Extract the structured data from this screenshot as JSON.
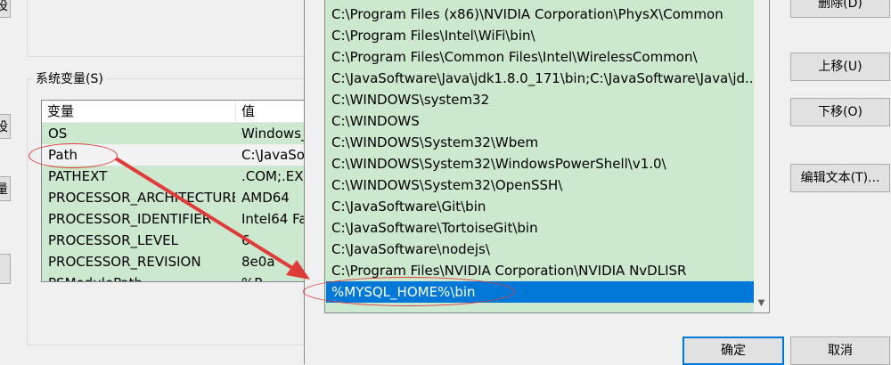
{
  "left_window": {
    "btn_fragments": [
      "设",
      "设",
      "量"
    ],
    "system_group_label": "系统变量(S)",
    "table": {
      "headers": [
        "变量",
        "值"
      ],
      "rows": [
        {
          "name": "OS",
          "value": "Windows_"
        },
        {
          "name": "Path",
          "value": "C:\\JavaSo"
        },
        {
          "name": "PATHEXT",
          "value": ".COM;.EX"
        },
        {
          "name": "PROCESSOR_ARCHITECTURE",
          "value": "AMD64"
        },
        {
          "name": "PROCESSOR_IDENTIFIER",
          "value": "Intel64 Fa"
        },
        {
          "name": "PROCESSOR_LEVEL",
          "value": "6"
        },
        {
          "name": "PROCESSOR_REVISION",
          "value": "8e0a"
        },
        {
          "name": "PSModulePath",
          "value": "%P"
        }
      ]
    }
  },
  "edit_dialog": {
    "path_items": [
      "C:\\Program Files (x86)\\NVIDIA Corporation\\PhysX\\Common",
      "C:\\Program Files\\Intel\\WiFi\\bin\\",
      "C:\\Program Files\\Common Files\\Intel\\WirelessCommon\\",
      "C:\\JavaSoftware\\Java\\jdk1.8.0_171\\bin;C:\\JavaSoftware\\Java\\jd...",
      "C:\\WINDOWS\\system32",
      "C:\\WINDOWS",
      "C:\\WINDOWS\\System32\\Wbem",
      "C:\\WINDOWS\\System32\\WindowsPowerShell\\v1.0\\",
      "C:\\WINDOWS\\System32\\OpenSSH\\",
      "C:\\JavaSoftware\\Git\\bin",
      "C:\\JavaSoftware\\TortoiseGit\\bin",
      "C:\\JavaSoftware\\nodejs\\",
      "C:\\Program Files\\NVIDIA Corporation\\NVIDIA NvDLISR",
      "%MYSQL_HOME%\\bin"
    ],
    "selected_index": 13,
    "buttons": {
      "delete": "删除(D)",
      "move_up": "上移(U)",
      "move_down": "下移(O)",
      "edit_text": "编辑文本(T)...",
      "ok": "确定",
      "cancel": "取消"
    }
  },
  "colors": {
    "list_bg": "#cce8cf",
    "selection": "#0078d7",
    "annotation": "#e03b3b"
  }
}
